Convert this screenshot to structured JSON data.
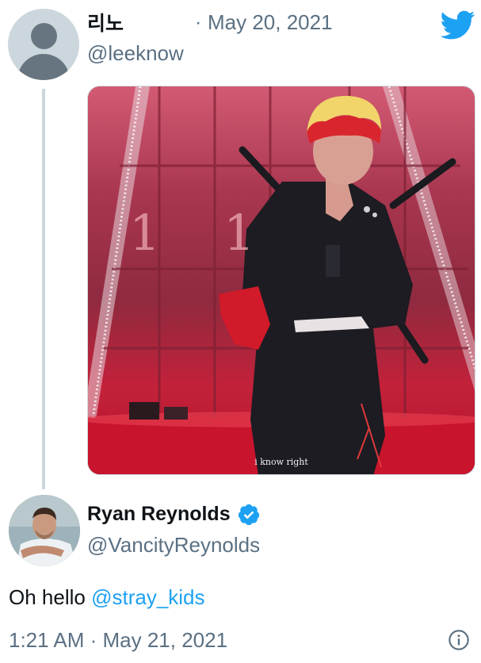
{
  "quoted_tweet": {
    "display_name": "리노",
    "separator": "·",
    "date": "May 20, 2021",
    "handle": "@leeknow",
    "media_caption": "i know right",
    "media_overlay_text": "1 1"
  },
  "tweet": {
    "display_name": "Ryan Reynolds",
    "handle": "@VancityReynolds",
    "text_prefix": "Oh hello ",
    "mention": "@stray_kids",
    "timestamp": "1:21 AM · May 21, 2021"
  },
  "icons": {
    "logo": "twitter-bird-icon",
    "verified": "verified-badge-icon",
    "info": "info-icon"
  },
  "colors": {
    "brand": "#1da1f2",
    "secondary_text": "#5b7083",
    "primary_text": "#0f1419"
  }
}
